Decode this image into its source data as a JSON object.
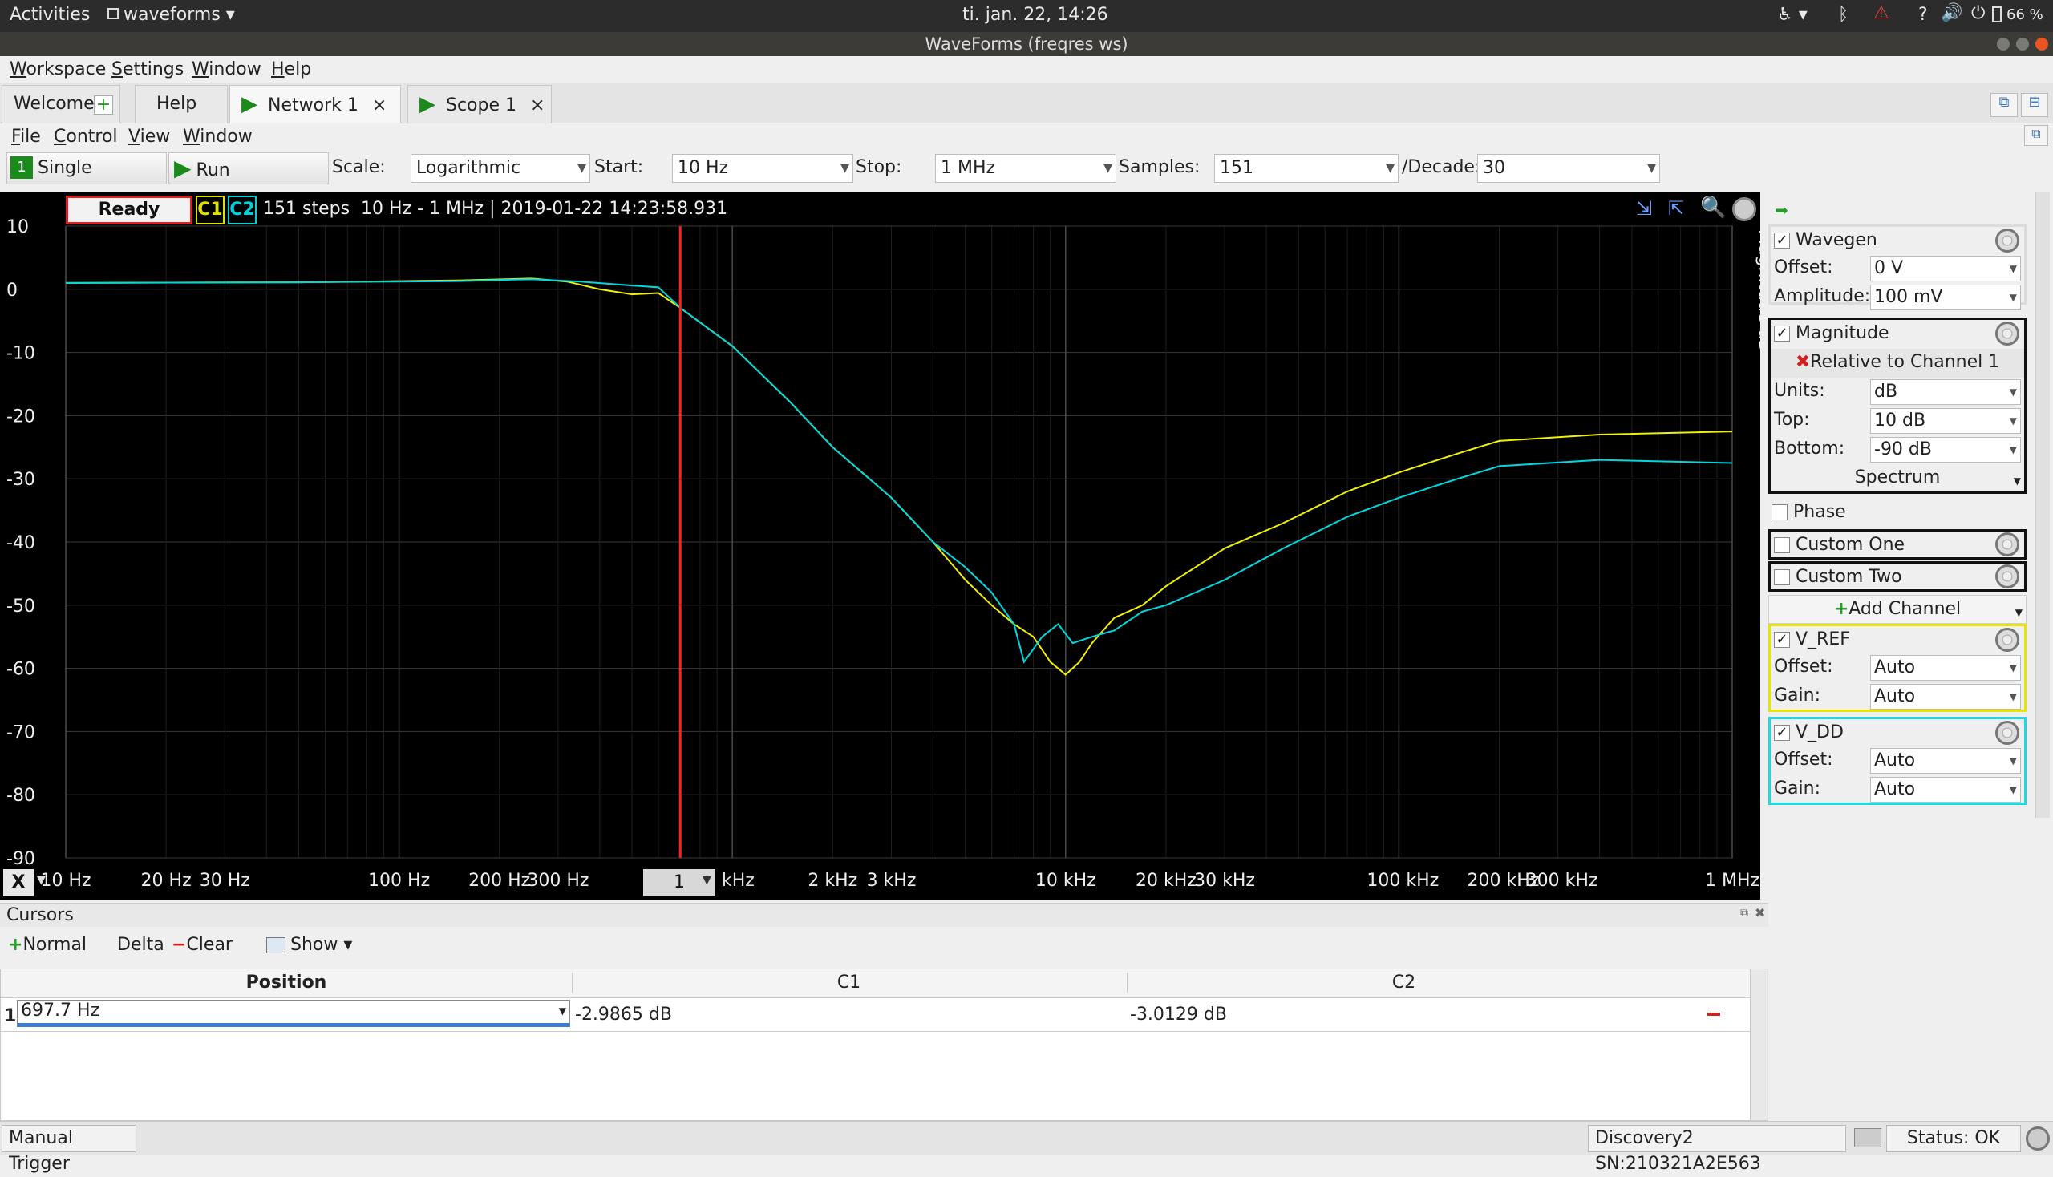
{
  "system_bar": {
    "activities": "Activities",
    "app_menu": "waveforms",
    "clock": "ti. jan. 22, 14:26",
    "battery": "66 %"
  },
  "window": {
    "title": "WaveForms (freqres ws)"
  },
  "main_menu": [
    "Workspace",
    "Settings",
    "Window",
    "Help"
  ],
  "tabs": [
    {
      "label": "Welcome"
    },
    {
      "label": "Help"
    },
    {
      "label": "Network 1"
    },
    {
      "label": "Scope 1"
    }
  ],
  "instrument_menu": [
    "File",
    "Control",
    "View",
    "Window"
  ],
  "toolbar": {
    "single_label": "Single",
    "run_label": "Run",
    "scale_label": "Scale:",
    "scale_value": "Logarithmic",
    "start_label": "Start:",
    "start_value": "10 Hz",
    "stop_label": "Stop:",
    "stop_value": "1 MHz",
    "samples_label": "Samples:",
    "samples_value": "151",
    "decade_label": "/Decade:",
    "decade_value": "30"
  },
  "plot": {
    "status": "Ready",
    "c1": "C1",
    "c2": "C2",
    "info": "151 steps  10 Hz - 1 MHz | 2019-01-22 14:23:58.931",
    "right_axis_title": "Magnitude dB",
    "x_unit_value": "1",
    "x_unit_label": "kHz",
    "x_axis_label": "X",
    "colors": {
      "c1": "#f0f000",
      "c2": "#00d8e0",
      "cursor": "#ff2020",
      "grid": "#3a3a3a"
    }
  },
  "chart_data": {
    "type": "line",
    "xscale": "log",
    "xlim": [
      10,
      1000000
    ],
    "ylim": [
      -90,
      10
    ],
    "yticks": [
      "10",
      "0",
      "-10",
      "-20",
      "-30",
      "-40",
      "-50",
      "-60",
      "-70",
      "-80",
      "-90"
    ],
    "xticks": [
      {
        "value": 10,
        "label": "10 Hz"
      },
      {
        "value": 20,
        "label": "20 Hz"
      },
      {
        "value": 30,
        "label": "30 Hz"
      },
      {
        "value": 100,
        "label": "100 Hz"
      },
      {
        "value": 200,
        "label": "200 Hz"
      },
      {
        "value": 300,
        "label": "300 Hz"
      },
      {
        "value": 2000,
        "label": "2 kHz"
      },
      {
        "value": 3000,
        "label": "3 kHz"
      },
      {
        "value": 10000,
        "label": "10 kHz"
      },
      {
        "value": 20000,
        "label": "20 kHz"
      },
      {
        "value": 30000,
        "label": "30 kHz"
      },
      {
        "value": 100000,
        "label": "100 kHz"
      },
      {
        "value": 200000,
        "label": "200 kHz"
      },
      {
        "value": 300000,
        "label": "300 kHz"
      },
      {
        "value": 1000000,
        "label": "1 MHz"
      }
    ],
    "cursor_x": 697.7,
    "series": [
      {
        "name": "C1",
        "color": "#f0f000",
        "points": [
          [
            10,
            1.0
          ],
          [
            50,
            1.1
          ],
          [
            150,
            1.4
          ],
          [
            250,
            1.7
          ],
          [
            320,
            1.2
          ],
          [
            400,
            0.0
          ],
          [
            500,
            -0.8
          ],
          [
            600,
            -0.6
          ],
          [
            700,
            -3.0
          ],
          [
            1000,
            -9
          ],
          [
            1500,
            -18
          ],
          [
            2000,
            -25
          ],
          [
            3000,
            -33
          ],
          [
            4000,
            -40
          ],
          [
            5000,
            -46
          ],
          [
            6000,
            -50
          ],
          [
            7000,
            -53
          ],
          [
            8000,
            -55
          ],
          [
            9000,
            -59
          ],
          [
            10000,
            -61
          ],
          [
            11000,
            -59
          ],
          [
            12000,
            -56
          ],
          [
            14000,
            -52
          ],
          [
            17000,
            -50
          ],
          [
            20000,
            -47
          ],
          [
            30000,
            -41
          ],
          [
            45000,
            -37
          ],
          [
            70000,
            -32
          ],
          [
            100000,
            -29
          ],
          [
            150000,
            -26
          ],
          [
            200000,
            -24
          ],
          [
            400000,
            -23
          ],
          [
            1000000,
            -22.5
          ]
        ]
      },
      {
        "name": "C2",
        "color": "#00d8e0",
        "points": [
          [
            10,
            1.0
          ],
          [
            50,
            1.1
          ],
          [
            150,
            1.3
          ],
          [
            250,
            1.6
          ],
          [
            350,
            1.2
          ],
          [
            500,
            0.6
          ],
          [
            600,
            0.3
          ],
          [
            700,
            -3.0
          ],
          [
            1000,
            -9
          ],
          [
            1500,
            -18
          ],
          [
            2000,
            -25
          ],
          [
            3000,
            -33
          ],
          [
            4000,
            -40
          ],
          [
            5000,
            -44
          ],
          [
            6000,
            -48
          ],
          [
            7000,
            -53
          ],
          [
            7500,
            -59
          ],
          [
            8500,
            -55
          ],
          [
            9500,
            -53
          ],
          [
            10500,
            -56
          ],
          [
            12000,
            -55
          ],
          [
            14000,
            -54
          ],
          [
            17000,
            -51
          ],
          [
            20000,
            -50
          ],
          [
            30000,
            -46
          ],
          [
            45000,
            -41
          ],
          [
            70000,
            -36
          ],
          [
            100000,
            -33
          ],
          [
            150000,
            -30
          ],
          [
            200000,
            -28
          ],
          [
            400000,
            -27
          ],
          [
            1000000,
            -27.5
          ]
        ]
      }
    ]
  },
  "right_panel": {
    "wavegen": {
      "label": "Wavegen",
      "offset_label": "Offset:",
      "offset_value": "0 V",
      "amplitude_label": "Amplitude:",
      "amplitude_value": "100 mV"
    },
    "magnitude": {
      "label": "Magnitude",
      "relative": "Relative to Channel 1",
      "units_label": "Units:",
      "units_value": "dB",
      "top_label": "Top:",
      "top_value": "10 dB",
      "bottom_label": "Bottom:",
      "bottom_value": "-90 dB",
      "spectrum_label": "Spectrum"
    },
    "phase_label": "Phase",
    "custom_one_label": "Custom One",
    "custom_two_label": "Custom Two",
    "add_channel_label": "Add Channel",
    "vref": {
      "label": "V_REF",
      "offset_label": "Offset:",
      "offset_value": "Auto",
      "gain_label": "Gain:",
      "gain_value": "Auto"
    },
    "vdd": {
      "label": "V_DD",
      "offset_label": "Offset:",
      "offset_value": "Auto",
      "gain_label": "Gain:",
      "gain_value": "Auto"
    }
  },
  "cursors": {
    "title": "Cursors",
    "normal_label": "Normal",
    "delta_label": "Delta",
    "clear_label": "Clear",
    "show_label": "Show",
    "headers": [
      "Position",
      "C1",
      "C2"
    ],
    "rows": [
      {
        "index": "1",
        "position": "697.7 Hz",
        "c1": "-2.9865 dB",
        "c2": "-3.0129 dB"
      }
    ]
  },
  "status_bar": {
    "manual_trigger": "Manual Trigger",
    "device": "Discovery2 SN:210321A2E563",
    "status": "Status: OK"
  }
}
